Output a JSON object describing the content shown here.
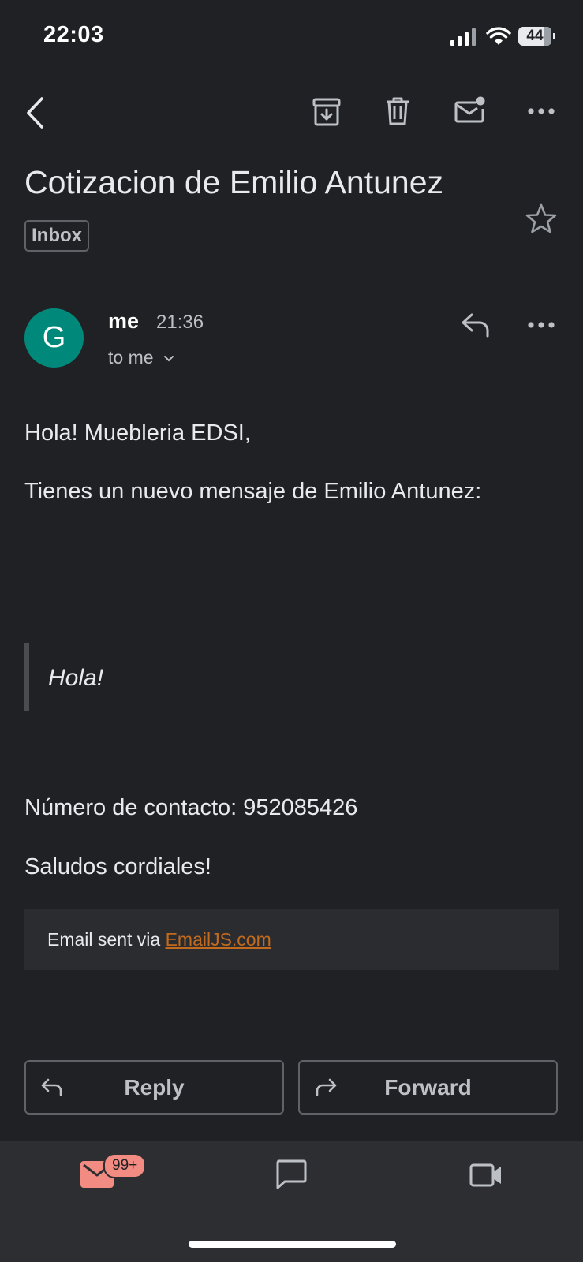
{
  "status_bar": {
    "time": "22:03",
    "battery": "44"
  },
  "toolbar": {
    "back_icon": "chevron-left-icon",
    "archive_icon": "archive-icon",
    "delete_icon": "trash-icon",
    "mark_unread_icon": "mark-unread-icon",
    "more_icon": "more-horizontal-icon"
  },
  "email": {
    "subject": "Cotizacion de Emilio Antunez",
    "label": "Inbox",
    "star_icon": "star-outline-icon",
    "sender": {
      "avatar_letter": "G",
      "avatar_color": "#00897b",
      "name": "me",
      "time": "21:36",
      "recipient": "to me"
    },
    "body": {
      "greeting": "Hola! Muebleria EDSI,",
      "intro": "Tienes un nuevo mensaje de Emilio Antunez:",
      "quote": "Hola!",
      "contact": "Número de contacto: 952085426",
      "closing": "Saludos cordiales!",
      "footer_prefix": "Email sent via ",
      "footer_link": "EmailJS.com"
    }
  },
  "actions": {
    "reply": "Reply",
    "forward": "Forward"
  },
  "bottom_nav": {
    "mail_badge": "99+",
    "items": [
      "mail-icon",
      "chat-icon",
      "meet-video-icon"
    ],
    "accent_color": "#f28b82"
  }
}
